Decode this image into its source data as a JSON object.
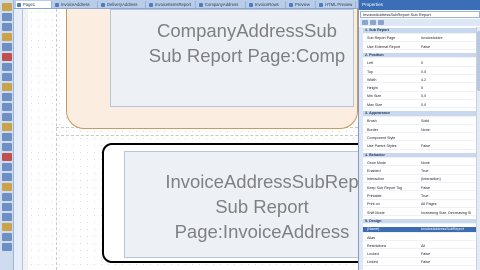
{
  "tabs": [
    {
      "label": "Page1"
    },
    {
      "label": "InvoiceAddress"
    },
    {
      "label": "DeliveryAddress"
    },
    {
      "label": "InvoiceItemsReport"
    },
    {
      "label": "CompanyAddress"
    },
    {
      "label": "InvoiceRows"
    },
    {
      "label": "Preview"
    },
    {
      "label": "HTML Preview"
    }
  ],
  "canvas": {
    "sub1_text": "CompanyAddressSub\nSub Report Page:Comp",
    "sub2_text": "InvoiceAddressSubRep\nSub Report\nPage:InvoiceAddress"
  },
  "properties": {
    "title": "Properties",
    "object": "InvoiceAddressSubReport  Sub Report",
    "rows": [
      {
        "kind": "cat",
        "name": "1. Sub Report",
        "value": ""
      },
      {
        "kind": "prop",
        "name": "Sub Report Page",
        "value": "InvoiceAddre"
      },
      {
        "kind": "prop",
        "name": "Use External Report",
        "value": "False"
      },
      {
        "kind": "cat",
        "name": "2. Position",
        "value": ""
      },
      {
        "kind": "prop",
        "name": "Left",
        "value": "0"
      },
      {
        "kind": "prop",
        "name": "Top",
        "value": "0.5"
      },
      {
        "kind": "prop",
        "name": "Width",
        "value": "4.2"
      },
      {
        "kind": "prop",
        "name": "Height",
        "value": "5"
      },
      {
        "kind": "prop",
        "name": "Min Size",
        "value": "0,0"
      },
      {
        "kind": "prop",
        "name": "Max Size",
        "value": "0,0"
      },
      {
        "kind": "cat",
        "name": "3. Appearance",
        "value": ""
      },
      {
        "kind": "prop",
        "name": "Brush",
        "value": "Solid"
      },
      {
        "kind": "prop",
        "name": "Border",
        "value": "None"
      },
      {
        "kind": "prop",
        "name": "Component Style",
        "value": ""
      },
      {
        "kind": "prop",
        "name": "Use Parent Styles",
        "value": "False"
      },
      {
        "kind": "cat",
        "name": "4. Behavior",
        "value": ""
      },
      {
        "kind": "prop",
        "name": "Grow Mode",
        "value": "None"
      },
      {
        "kind": "prop",
        "name": "Enabled",
        "value": "True"
      },
      {
        "kind": "prop",
        "name": "Interaction",
        "value": "(Interaction)"
      },
      {
        "kind": "prop",
        "name": "Keep Sub Report Tog",
        "value": "False"
      },
      {
        "kind": "prop",
        "name": "Printable",
        "value": "True"
      },
      {
        "kind": "prop",
        "name": "Print on",
        "value": "All Pages"
      },
      {
        "kind": "prop",
        "name": "Shift Mode",
        "value": "Increasing Size, Decreasing Si"
      },
      {
        "kind": "cat",
        "name": "5. Design",
        "value": ""
      },
      {
        "kind": "sel",
        "name": "(Name)",
        "value": "InvoiceAddressSubReport"
      },
      {
        "kind": "prop",
        "name": "Alias",
        "value": ""
      },
      {
        "kind": "prop",
        "name": "Restrictions",
        "value": "All"
      },
      {
        "kind": "prop",
        "name": "Locked",
        "value": "False"
      },
      {
        "kind": "prop",
        "name": "Linked",
        "value": "False"
      }
    ]
  }
}
